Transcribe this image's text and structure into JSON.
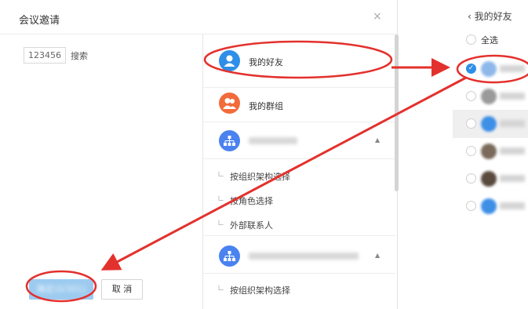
{
  "dialog": {
    "title": "会议邀请",
    "close_glyph": "×",
    "search_code": "123456",
    "search_label": "搜索",
    "confirm_label": "确定(0/301)",
    "cancel_label": "取 消"
  },
  "middle": {
    "my_friends": "我的好友",
    "my_groups": "我的群组",
    "org_sub_items": [
      "按组织架构选择",
      "按角色选择",
      "外部联系人"
    ],
    "org2_sub_items": [
      "按组织架构选择"
    ],
    "collapse_glyph": "▲",
    "prefix_glyph": "∟"
  },
  "right_panel": {
    "back_label": "‹ 我的好友",
    "select_all": "全选",
    "check_glyph": "✓"
  },
  "colors": {
    "accent_blue": "#2f8ee8",
    "group_orange": "#f26b3a",
    "org_blue": "#4a82f0",
    "annotation_red": "#e3312d",
    "confirm_disabled": "#9dcbef"
  },
  "icons": {
    "friends": "person-icon",
    "groups": "group-icon",
    "org": "org-tree-icon"
  }
}
